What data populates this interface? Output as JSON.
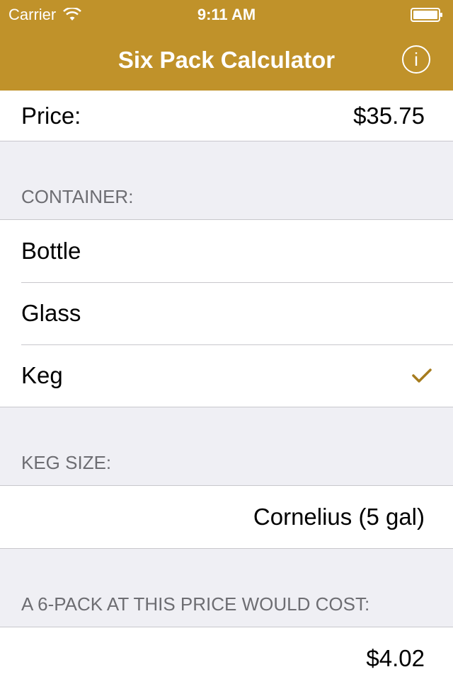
{
  "status_bar": {
    "carrier": "Carrier",
    "time": "9:11 AM"
  },
  "nav": {
    "title": "Six Pack Calculator",
    "info_icon": "i"
  },
  "price": {
    "label": "Price:",
    "value": "$35.75"
  },
  "container": {
    "header": "CONTAINER:",
    "options": [
      "Bottle",
      "Glass",
      "Keg"
    ],
    "selected": "Keg"
  },
  "keg_size": {
    "header": "KEG SIZE:",
    "value": "Cornelius (5 gal)"
  },
  "result": {
    "header": "A 6-PACK AT THIS PRICE WOULD COST:",
    "value": "$4.02"
  },
  "colors": {
    "accent": "#c0922a",
    "check": "#a67c1e"
  }
}
